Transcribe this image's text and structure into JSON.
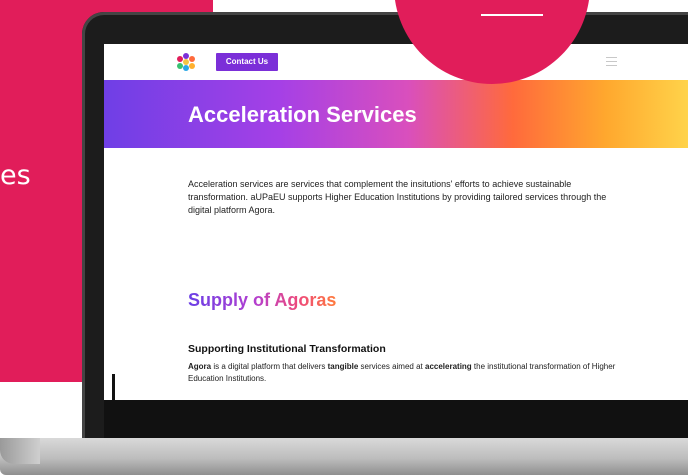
{
  "left_panel": {
    "partial_text": "es"
  },
  "site": {
    "contact_button": "Contact Us",
    "hero_title": "Acceleration Services",
    "intro_text": "Acceleration services are services that complement the insitutions' efforts to achieve sustainable transformation. aUPaEU supports Higher Education Institutions by providing tailored services through the digital platform Agora.",
    "section_title": "Supply of Agoras",
    "subsection_title": "Supporting Institutional Transformation",
    "body": {
      "p1": "Agora",
      "p2": " is a digital platform that delivers ",
      "p3": "tangible",
      "p4": " services aimed at ",
      "p5": "accelerating",
      "p6": " the institutional transformation of Higher Education Institutions."
    }
  },
  "colors": {
    "brand_pink": "#e11d5a",
    "button_purple": "#7b2fd8",
    "gradient": [
      "#6f3fe6",
      "#a540e6",
      "#d94fbd",
      "#ff6a3c",
      "#ffa82e",
      "#ffd34a"
    ]
  },
  "icons": [
    "flower-logo-icon",
    "hamburger-menu-icon"
  ]
}
